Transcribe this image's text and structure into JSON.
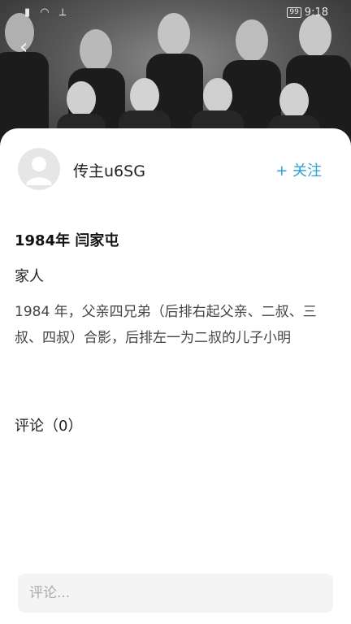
{
  "status_bar": {
    "time": "9:18",
    "battery": "99"
  },
  "icons": {
    "back": "back-chevron-icon",
    "avatar": "default-avatar-icon"
  },
  "author": {
    "name": "传主u6SG",
    "follow_label": "+ 关注"
  },
  "post": {
    "title": "1984年  闫家屯",
    "category": "家人",
    "description": "1984 年，父亲四兄弟（后排右起父亲、二叔、三叔、四叔）合影，后排左一为二叔的儿子小明"
  },
  "comments": {
    "count_label": "评论（0）",
    "input_placeholder": "评论..."
  },
  "colors": {
    "accent": "#2f9fd6",
    "card_bg": "#ffffff",
    "input_bg": "#f4f4f4"
  }
}
